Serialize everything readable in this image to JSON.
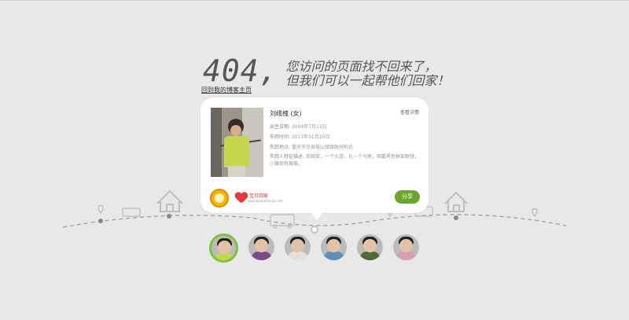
{
  "error": {
    "code": "404,",
    "line1": "您访问的页面找不回来了，",
    "line2": "但我们可以一起帮他们回家！"
  },
  "home_link": "回到我的博客主页",
  "card": {
    "name": "刘峨槐 (女)",
    "detail_link": "查看详情",
    "fields": [
      {
        "label": "出生日期:",
        "value": "2004年7月15日"
      },
      {
        "label": "失踪时间:",
        "value": "2017年01月20日"
      },
      {
        "label": "失踪地点:",
        "value": "重庆市忠县拔山镇镇政府附近"
      },
      {
        "label": "失踪人特征描述:",
        "value": "单眼皮，一个头旋，扎一个马尾，佩戴黑色框架眼镜，小腹部有瘢痕。"
      }
    ],
    "logo_text": "宝贝回家",
    "logo_sub": "www.baobeihuijia.com",
    "share_label": "分享"
  },
  "thumbs": [
    {
      "shirt": "#c6d54e"
    },
    {
      "shirt": "#7a4c8c"
    },
    {
      "shirt": "#e8e0d8"
    },
    {
      "shirt": "#5d8fb8"
    },
    {
      "shirt": "#4f6a3a"
    },
    {
      "shirt": "#d8a0b4"
    }
  ],
  "colors": {
    "accent": "#6aa52e",
    "active_ring": "#7fc242"
  }
}
